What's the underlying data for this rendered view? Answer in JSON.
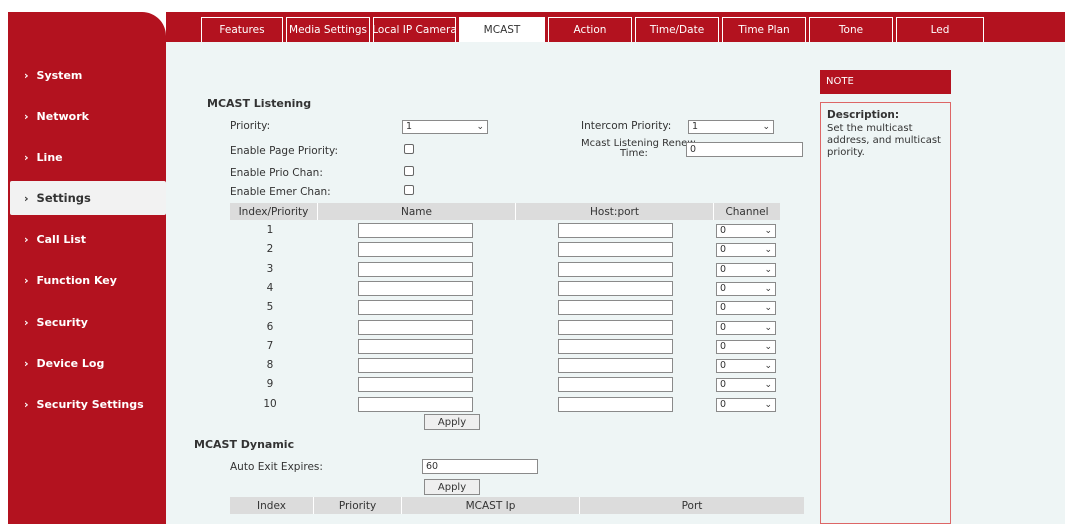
{
  "tabs": [
    {
      "label": "Features",
      "active": false
    },
    {
      "label": "Media Settings",
      "active": false
    },
    {
      "label": "Local IP Camera",
      "active": false
    },
    {
      "label": "MCAST",
      "active": true
    },
    {
      "label": "Action",
      "active": false
    },
    {
      "label": "Time/Date",
      "active": false
    },
    {
      "label": "Time Plan",
      "active": false
    },
    {
      "label": "Tone",
      "active": false
    },
    {
      "label": "Led",
      "active": false
    }
  ],
  "sidebar": {
    "items": [
      {
        "label": "System",
        "active": false
      },
      {
        "label": "Network",
        "active": false
      },
      {
        "label": "Line",
        "active": false
      },
      {
        "label": "Settings",
        "active": true
      },
      {
        "label": "Call List",
        "active": false
      },
      {
        "label": "Function Key",
        "active": false
      },
      {
        "label": "Security",
        "active": false
      },
      {
        "label": "Device Log",
        "active": false
      },
      {
        "label": "Security Settings",
        "active": false
      }
    ],
    "chevron": "›"
  },
  "listening": {
    "title": "MCAST Listening",
    "priority_label": "Priority:",
    "priority_value": "1",
    "intercom_priority_label": "Intercom Priority:",
    "intercom_priority_value": "1",
    "enable_page_priority_label": "Enable Page Priority:",
    "renew_time_label_1": "Mcast Listening Renew",
    "renew_time_label_2": "Time:",
    "renew_time_value": "0",
    "enable_prio_chan_label": "Enable Prio Chan:",
    "enable_emer_chan_label": "Enable Emer Chan:",
    "table": {
      "headers": [
        "Index/Priority",
        "Name",
        "Host:port",
        "Channel"
      ],
      "rows": [
        {
          "index": "1",
          "name": "",
          "host": "",
          "channel": "0"
        },
        {
          "index": "2",
          "name": "",
          "host": "",
          "channel": "0"
        },
        {
          "index": "3",
          "name": "",
          "host": "",
          "channel": "0"
        },
        {
          "index": "4",
          "name": "",
          "host": "",
          "channel": "0"
        },
        {
          "index": "5",
          "name": "",
          "host": "",
          "channel": "0"
        },
        {
          "index": "6",
          "name": "",
          "host": "",
          "channel": "0"
        },
        {
          "index": "7",
          "name": "",
          "host": "",
          "channel": "0"
        },
        {
          "index": "8",
          "name": "",
          "host": "",
          "channel": "0"
        },
        {
          "index": "9",
          "name": "",
          "host": "",
          "channel": "0"
        },
        {
          "index": "10",
          "name": "",
          "host": "",
          "channel": "0"
        }
      ]
    },
    "apply_label": "Apply"
  },
  "dynamic": {
    "title": "MCAST Dynamic",
    "auto_exit_label": "Auto Exit Expires:",
    "auto_exit_value": "60",
    "apply_label": "Apply",
    "headers": [
      "Index",
      "Priority",
      "MCAST Ip",
      "Port"
    ]
  },
  "note": {
    "header": "NOTE",
    "title": "Description:",
    "text": "Set the multicast address, and multicast priority."
  },
  "colors": {
    "brand": "#b3121f",
    "content_bg": "#eef5f5",
    "table_header": "#dcdcdc"
  },
  "icons": {
    "dropdown": "chevron-down-icon",
    "sidebar": "chevron-right-icon"
  }
}
